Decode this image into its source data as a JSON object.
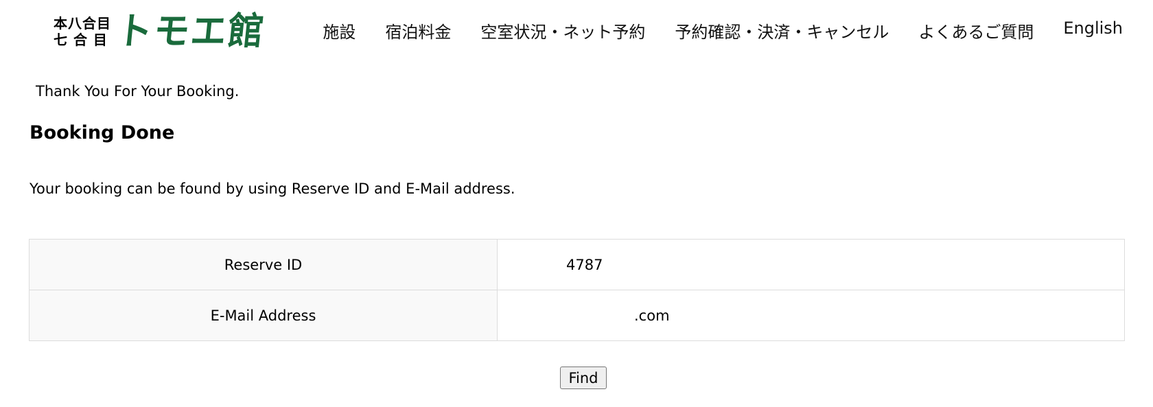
{
  "header": {
    "logo": {
      "small_line1": "本八合目",
      "small_line2": "七 合 目",
      "name": "トモエ館",
      "brand_color": "#1a6b3c"
    },
    "nav": [
      {
        "label": "施設"
      },
      {
        "label": "宿泊料金"
      },
      {
        "label": "空室状況・ネット予約"
      },
      {
        "label": "予約確認・決済・キャンセル"
      },
      {
        "label": "よくあるご質問"
      },
      {
        "label": "English"
      }
    ]
  },
  "main": {
    "thanks": "Thank You For Your Booking.",
    "title": "Booking Done",
    "description": "Your booking can be found by using Reserve ID and E-Mail address.",
    "table": [
      {
        "label": "Reserve ID",
        "value": "4787"
      },
      {
        "label": "E-Mail Address",
        "value": ".com"
      }
    ],
    "find_button": "Find"
  }
}
